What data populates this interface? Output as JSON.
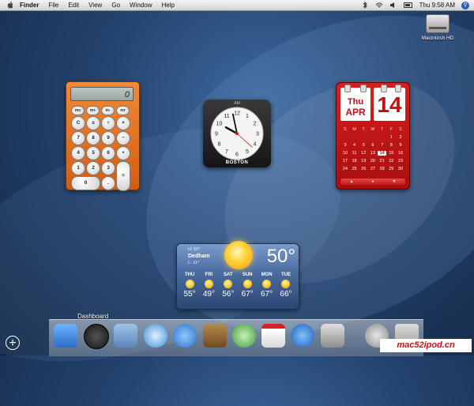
{
  "menubar": {
    "app": "Finder",
    "items": [
      "File",
      "Edit",
      "View",
      "Go",
      "Window",
      "Help"
    ],
    "clock": "Thu 9:58 AM"
  },
  "desktop": {
    "hd_label": "Macintosh HD"
  },
  "calculator": {
    "display": "0",
    "keys": [
      "mc",
      "m+",
      "m-",
      "mr",
      "C",
      "±",
      "÷",
      "×",
      "7",
      "8",
      "9",
      "−",
      "4",
      "5",
      "6",
      "+",
      "1",
      "2",
      "3",
      "=",
      "0",
      "."
    ]
  },
  "clock_widget": {
    "ampm": "AM",
    "city": "BOSTON",
    "hour": 9,
    "minute": 58,
    "second": 22
  },
  "calendar": {
    "day": "Thu",
    "month": "APR",
    "date": "14",
    "weekdays": [
      "S",
      "M",
      "T",
      "W",
      "T",
      "F",
      "S"
    ],
    "weeks": [
      [
        "",
        "",
        "",
        "",
        "",
        "1",
        "2"
      ],
      [
        "3",
        "4",
        "5",
        "6",
        "7",
        "8",
        "9"
      ],
      [
        "10",
        "11",
        "12",
        "13",
        "14",
        "15",
        "16"
      ],
      [
        "17",
        "18",
        "19",
        "20",
        "21",
        "22",
        "23"
      ],
      [
        "24",
        "25",
        "26",
        "27",
        "28",
        "29",
        "30"
      ]
    ],
    "today": "14"
  },
  "weather": {
    "hi": "H: 50°",
    "city": "Dedham",
    "lo": "L: 31°",
    "temp": "50°",
    "forecast": [
      {
        "day": "THU",
        "temp": "55°"
      },
      {
        "day": "FRI",
        "temp": "49°"
      },
      {
        "day": "SAT",
        "temp": "56°"
      },
      {
        "day": "SUN",
        "temp": "67°"
      },
      {
        "day": "MON",
        "temp": "67°"
      },
      {
        "day": "TUE",
        "temp": "66°"
      }
    ]
  },
  "dock": {
    "label": "Dashboard",
    "watermark": "mac52ipod.cn",
    "icons": [
      "finder-icon",
      "dashboard-icon",
      "mail-icon",
      "safari-icon",
      "ichat-icon",
      "address-book-icon",
      "itunes-icon",
      "ical-icon",
      "quicktime-icon",
      "system-preferences-icon",
      "downloads-stack-icon",
      "trash-icon"
    ]
  },
  "colors": {
    "calculator_body": "#e0701f",
    "calendar_body": "#c41616",
    "weather_body": "#4d6fa3",
    "watermark_text": "#d01010"
  }
}
